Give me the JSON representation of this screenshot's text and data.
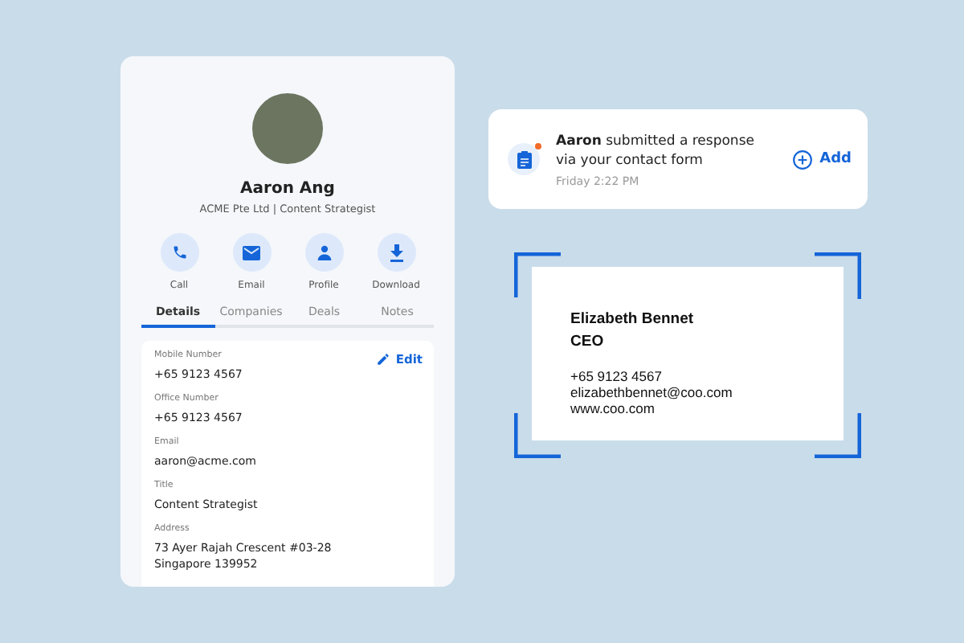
{
  "profile": {
    "name": "Aaron Ang",
    "subtitle": "ACME Pte Ltd | Content Strategist",
    "actions": [
      {
        "kind": "call",
        "label": "Call"
      },
      {
        "kind": "email",
        "label": "Email"
      },
      {
        "kind": "profile",
        "label": "Profile"
      },
      {
        "kind": "download",
        "label": "Download"
      }
    ],
    "tabs": [
      {
        "label": "Details",
        "selected": true
      },
      {
        "label": "Companies",
        "selected": false
      },
      {
        "label": "Deals",
        "selected": false
      },
      {
        "label": "Notes",
        "selected": false
      }
    ],
    "edit": "Edit",
    "fields": [
      {
        "label": "Mobile Number",
        "value": "+65 9123 4567"
      },
      {
        "label": "Office Number",
        "value": "+65 9123 4567"
      },
      {
        "label": "Email",
        "value": "aaron@acme.com"
      },
      {
        "label": "Title",
        "value": "Content Strategist"
      },
      {
        "label": "Address",
        "value": "73 Ayer Rajah Crescent #03-28",
        "value_2": "Singapore 139952"
      }
    ]
  },
  "notification": {
    "message": "**Aaron** submitted a response via your contact form",
    "time": "Friday 2:22 PM",
    "unread": true,
    "action": "Add"
  },
  "business_card": {
    "name": "Elizabeth Bennet",
    "title": "CEO",
    "lines": [
      "+65 9123 4567",
      "elizabethbennet@coo.com",
      "www.coo.com"
    ]
  }
}
